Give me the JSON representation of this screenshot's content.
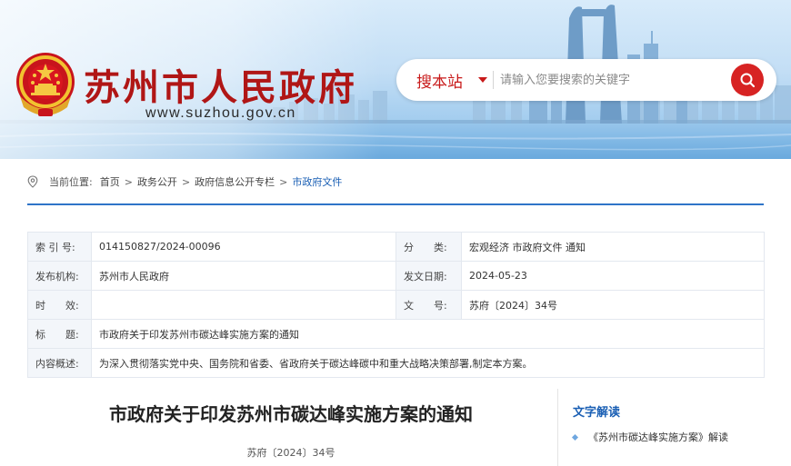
{
  "header": {
    "site_title": "苏州市人民政府",
    "site_url": "www.suzhou.gov.cn",
    "emblem_icon": "national-emblem-icon",
    "search": {
      "scope_label": "搜本站",
      "placeholder": "请输入您要搜索的关键字",
      "button_icon": "search-icon"
    }
  },
  "breadcrumb": {
    "prefix": "当前位置:",
    "items": [
      "首页",
      "政务公开",
      "政府信息公开专栏",
      "市政府文件"
    ],
    "separator": ">"
  },
  "info": {
    "index_label": "索 引 号:",
    "index_value": "014150827/2024-00096",
    "category_label": "分　　类:",
    "category_value": "宏观经济 市政府文件 通知",
    "publisher_label": "发布机构:",
    "publisher_value": "苏州市人民政府",
    "date_label": "发文日期:",
    "date_value": "2024-05-23",
    "validity_label": "时　　效:",
    "validity_value": "",
    "docno_label": "文　　号:",
    "docno_value": "苏府〔2024〕34号",
    "title_label": "标　　题:",
    "title_value": "市政府关于印发苏州市碳达峰实施方案的通知",
    "summary_label": "内容概述:",
    "summary_value": "为深入贯彻落实党中央、国务院和省委、省政府关于碳达峰碳中和重大战略决策部署,制定本方案。"
  },
  "article": {
    "title": "市政府关于印发苏州市碳达峰实施方案的通知",
    "doc_number": "苏府〔2024〕34号"
  },
  "sidebar": {
    "heading": "文字解读",
    "items": [
      "《苏州市碳达峰实施方案》解读"
    ]
  },
  "colors": {
    "brand_red": "#b01616",
    "accent_blue": "#1a5fb4",
    "search_button": "#d72323"
  }
}
